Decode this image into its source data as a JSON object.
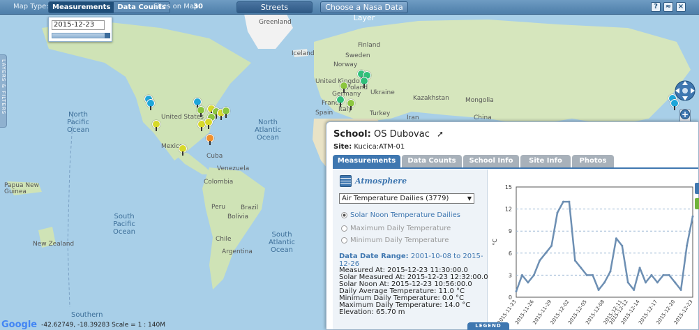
{
  "toolbar": {
    "map_type_label": "Map Type:",
    "measurements_label": "Measurements",
    "data_counts_label": "Data Counts",
    "sites_on_map_label": "Sites on Map:",
    "sites_count": "30",
    "streets_label": "Streets",
    "nasa_layer_label": "Choose a Nasa Data Layer",
    "help_icon": "?",
    "colors": {
      "bar": "#4d7ea9",
      "active": "#1f4e79"
    }
  },
  "date_picker": {
    "value": "2015-12-23"
  },
  "layers_tab": {
    "label": "LAYERS & FILTERS"
  },
  "map_labels": {
    "greenland": "Greenland",
    "iceland": "Iceland",
    "north_pacific": "North\nPacific\nOcean",
    "north_atlantic": "North\nAtlantic\nOcean",
    "south_pacific": "South\nPacific\nOcean",
    "south_atlantic": "South\nAtlantic\nOcean",
    "southern": "Southern",
    "united_states": "United States",
    "mexico": "Mexico",
    "venezuela": "Venezuela",
    "colombia": "Colombia",
    "peru": "Peru",
    "bolivia": "Bolivia",
    "brazil": "Brazil",
    "chile": "Chile",
    "argentina": "Argentina",
    "finland": "Finland",
    "sweden": "Sweden",
    "norway": "Norway",
    "uk": "United Kingdom",
    "germany": "Germany",
    "poland": "Poland",
    "ukraine": "Ukraine",
    "france": "France",
    "spain": "Spain",
    "italy": "Italy",
    "kazakhstan": "Kazakhstan",
    "mongolia": "Mongolia",
    "china": "China",
    "turkey": "Turkey",
    "iran": "Iran",
    "papua": "Papua New\nGuinea",
    "new_zealand": "New Zealand",
    "cuba": "Cuba"
  },
  "panel": {
    "school_key": "School:",
    "school_name": "OS Dubovac",
    "site_key": "Site:",
    "site_name": "Kucica:ATM-01",
    "tabs": [
      "Measurements",
      "Data Counts",
      "School Info",
      "Site Info",
      "Photos"
    ],
    "section_title": "Atmosphere",
    "select_value": "Air Temperature Dailies (3779)",
    "radios": [
      "Solar Noon Temperature Dailies",
      "Maximum Daily Temperature",
      "Minimum Daily Temperature"
    ],
    "date_range_key": "Data Date Range:",
    "date_range_value": "2001-10-08 to 2015-12-26",
    "info_lines": [
      "Measured At: 2015-12-23 11:30:00.0",
      "Solar Measured At: 2015-12-23 12:32:00.0",
      "Solar Noon At: 2015-12-23 10:56:00.0",
      "Daily Average Temperature: 11.0 °C",
      "Minimum Daily Temperature: 0.0 °C",
      "Maximum Daily Temperature: 14.0 °C",
      "Elevation: 65.70 m"
    ]
  },
  "legend_label": "LEGEND",
  "footer": {
    "logo": "Google",
    "coords": "-42.62749, -18.39283 Scale = 1 : 140M"
  },
  "chart_data": {
    "type": "line",
    "ylabel": "°C",
    "ylim": [
      0,
      15
    ],
    "yticks": [
      0,
      3,
      6,
      9,
      12,
      15
    ],
    "x": [
      "2015-11-23",
      "2015-11-24",
      "2015-11-25",
      "2015-11-26",
      "2015-11-27",
      "2015-11-28",
      "2015-11-29",
      "2015-11-30",
      "2015-12-01",
      "2015-12-02",
      "2015-12-03",
      "2015-12-04",
      "2015-12-05",
      "2015-12-06",
      "2015-12-07",
      "2015-12-08",
      "2015-12-09",
      "2015-12-10",
      "2015-12-11",
      "2015-12-12",
      "2015-12-13",
      "2015-12-14",
      "2015-12-15",
      "2015-12-16",
      "2015-12-17",
      "2015-12-18",
      "2015-12-19",
      "2015-12-20",
      "2015-12-21",
      "2015-12-22",
      "2015-12-23"
    ],
    "xtick_labels": [
      "2015-11-23",
      "2015-11-26",
      "2015-11-29",
      "2015-12-02",
      "2015-12-05",
      "2015-12-08",
      "2015-12-11",
      "2015-12-12",
      "2015-12-14",
      "2015-12-17",
      "2015-12-20",
      "2015-12-23"
    ],
    "series": [
      {
        "values": [
          0.8,
          3,
          2,
          3,
          5,
          6,
          7,
          11.5,
          13,
          13,
          5,
          4,
          3,
          3,
          1,
          2,
          3.5,
          8,
          7,
          2,
          1,
          4,
          2,
          3,
          2,
          3,
          3,
          2,
          1,
          7,
          11
        ],
        "color": "#6d8fb3"
      }
    ],
    "grid": true
  }
}
